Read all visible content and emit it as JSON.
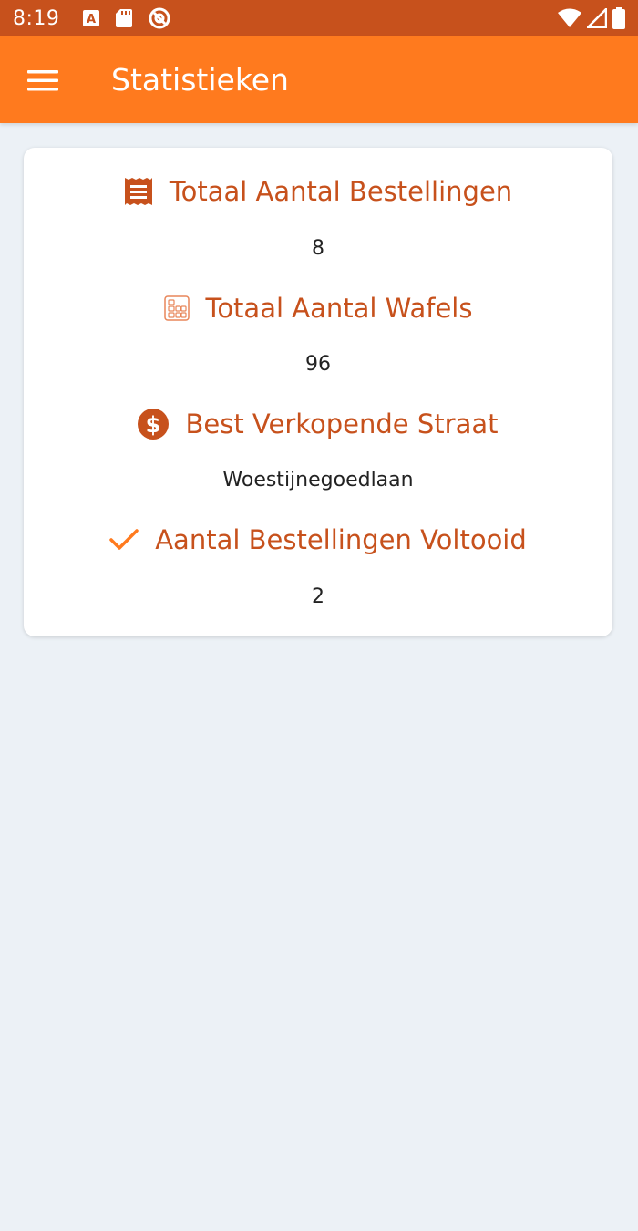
{
  "status_bar": {
    "time": "8:19",
    "icons": [
      "font-notification-icon",
      "sd-card-icon",
      "vpn-icon",
      "wifi-icon",
      "signal-icon",
      "battery-icon"
    ]
  },
  "app_bar": {
    "title": "Statistieken",
    "menu_icon": "hamburger-menu-icon",
    "color": "#FF7A1E"
  },
  "stats": [
    {
      "label": "Totaal Aantal Bestellingen",
      "value": "8",
      "icon": "receipt-icon"
    },
    {
      "label": "Totaal Aantal Wafels",
      "value": "96",
      "icon": "waffle-icon"
    },
    {
      "label": "Best Verkopende Straat",
      "value": "Woestijnegoedlaan",
      "icon": "dollar-coin-icon"
    },
    {
      "label": "Aantal Bestellingen Voltooid",
      "value": "2",
      "icon": "checkmark-icon"
    }
  ],
  "colors": {
    "status_bar": "#C7511C",
    "accent": "#FF7A1E",
    "label_text": "#C7511C",
    "background": "#ECF1F6"
  }
}
